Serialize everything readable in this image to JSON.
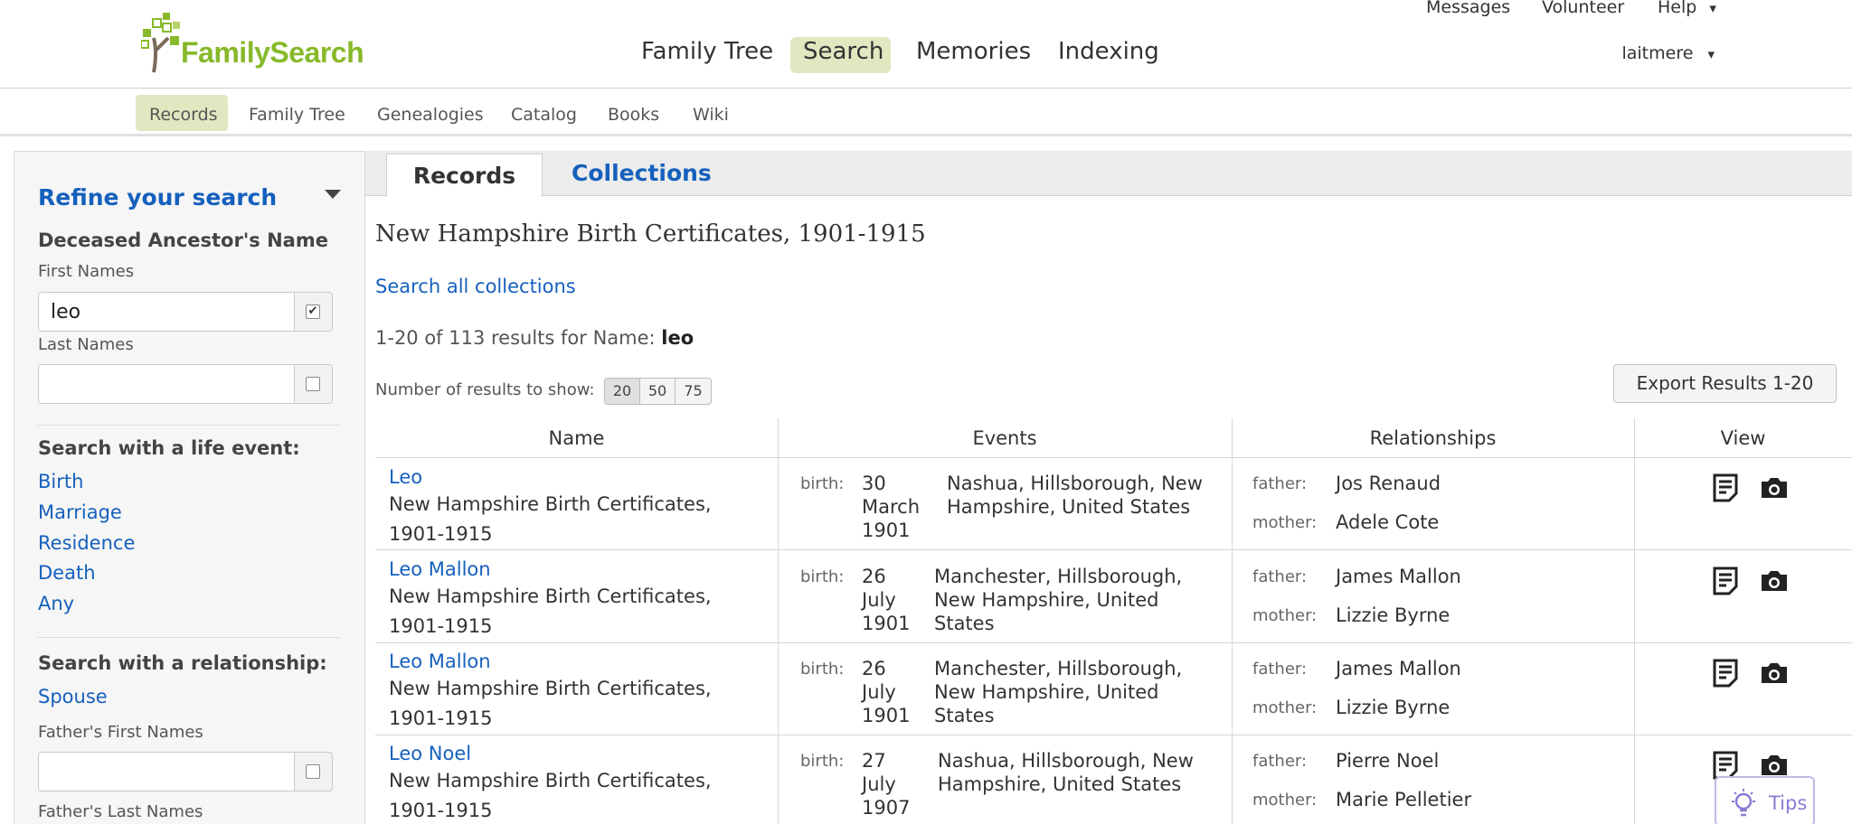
{
  "header": {
    "logo_text": "FamilySearch",
    "main_nav": [
      "Family Tree",
      "Search",
      "Memories",
      "Indexing"
    ],
    "util_links": [
      "Messages",
      "Volunteer",
      "Help"
    ],
    "user_name": "laitmere",
    "dropdown_arrow": "▾"
  },
  "subnav": [
    "Records",
    "Family Tree",
    "Genealogies",
    "Catalog",
    "Books",
    "Wiki"
  ],
  "sidebar": {
    "title": "Refine your search",
    "deceased_heading": "Deceased Ancestor's Name",
    "first_names_label": "First Names",
    "first_names_value": "leo",
    "last_names_label": "Last Names",
    "last_names_value": "",
    "life_event_heading": "Search with a life event:",
    "life_events": [
      "Birth",
      "Marriage",
      "Residence",
      "Death",
      "Any"
    ],
    "relationship_heading": "Search with a relationship:",
    "spouse_link": "Spouse",
    "fathers_first_label": "Father's First Names",
    "fathers_last_label": "Father's Last Names"
  },
  "tabs": {
    "records": "Records",
    "collections": "Collections"
  },
  "main": {
    "collection_title": "New Hampshire Birth Certificates, 1901-1915",
    "search_all": "Search all collections",
    "results_prefix": "1-20 of 113 results for Name: ",
    "results_query": "leo",
    "num_results_label": "Number of results to show:",
    "page_sizes": [
      "20",
      "50",
      "75"
    ],
    "export_label": "Export Results 1-20"
  },
  "table": {
    "headers": [
      "Name",
      "Events",
      "Relationships",
      "View"
    ],
    "event_label": "birth:",
    "father_label": "father:",
    "mother_label": "mother:",
    "rows": [
      {
        "name": "Leo",
        "collection_line1": "New Hampshire Birth Certificates,",
        "collection_line2": "1901-1915",
        "date_line1": "30",
        "date_line2": "March",
        "date_line3": "1901",
        "place_line1": "Nashua, Hillsborough, New",
        "place_line2": "Hampshire, United States",
        "place_line3": "",
        "father": "Jos Renaud",
        "mother": "Adele Cote"
      },
      {
        "name": "Leo Mallon",
        "collection_line1": "New Hampshire Birth Certificates,",
        "collection_line2": "1901-1915",
        "date_line1": "26",
        "date_line2": "July",
        "date_line3": "1901",
        "place_line1": "Manchester, Hillsborough,",
        "place_line2": "New Hampshire, United",
        "place_line3": "States",
        "father": "James Mallon",
        "mother": "Lizzie Byrne"
      },
      {
        "name": "Leo Mallon",
        "collection_line1": "New Hampshire Birth Certificates,",
        "collection_line2": "1901-1915",
        "date_line1": "26",
        "date_line2": "July",
        "date_line3": "1901",
        "place_line1": "Manchester, Hillsborough,",
        "place_line2": "New Hampshire, United",
        "place_line3": "States",
        "father": "James Mallon",
        "mother": "Lizzie Byrne"
      },
      {
        "name": "Leo Noel",
        "collection_line1": "New Hampshire Birth Certificates,",
        "collection_line2": "1901-1915",
        "date_line1": "27",
        "date_line2": "July",
        "date_line3": "1907",
        "place_line1": "Nashua, Hillsborough, New",
        "place_line2": "Hampshire, United States",
        "place_line3": "",
        "father": "Pierre Noel",
        "mother": "Marie Pelletier"
      }
    ]
  },
  "tips": {
    "label": "Tips"
  },
  "colors": {
    "brand_green": "#87b92a",
    "link_blue": "#1560bd",
    "active_pill": "#dfe8c0",
    "tips_purple": "#8c7ad3"
  },
  "icons": {
    "logo": "family-tree-logo-icon",
    "dropdown": "caret-down-icon",
    "checkbox": "checkbox-icon",
    "record": "document-icon",
    "image": "camera-icon",
    "tips": "lightbulb-icon"
  }
}
